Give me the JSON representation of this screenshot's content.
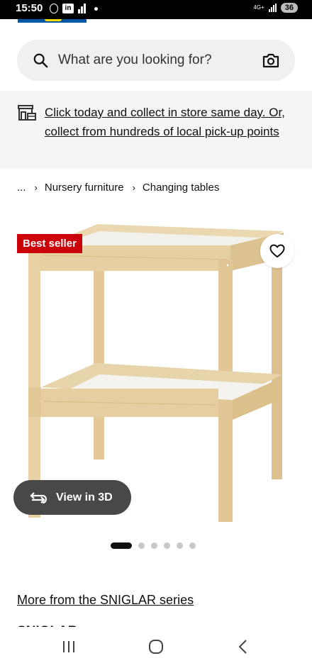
{
  "status_bar": {
    "time": "15:50",
    "network": "4G+",
    "battery": "36"
  },
  "search": {
    "placeholder": "What are you looking for?",
    "icon": "search-icon",
    "camera_icon": "camera-icon"
  },
  "collect_banner": {
    "icon": "store-icon",
    "text": "Click today and collect in store same day. Or, collect from hundreds of local pick-up points"
  },
  "breadcrumb": {
    "ellipsis": "...",
    "separator": "›",
    "items": [
      "Nursery furniture",
      "Changing tables"
    ]
  },
  "product": {
    "badge": "Best seller",
    "favourite_icon": "heart-icon",
    "view_3d_label": "View in 3D",
    "view_3d_icon": "rotate-icon",
    "carousel": {
      "count": 6,
      "active_index": 0
    },
    "series_link": "More from the SNIGLAR series",
    "name_partial": "SNIGLAR"
  },
  "colors": {
    "badge_red": "#cc0008",
    "view3d_bg": "#484848",
    "banner_bg": "#f5f5f5",
    "search_bg": "#f0f0f0",
    "wood": "#e8d2a6"
  },
  "nav_bar": {
    "recent_icon": "recent-apps-icon",
    "home_icon": "home-icon",
    "back_icon": "back-icon"
  }
}
